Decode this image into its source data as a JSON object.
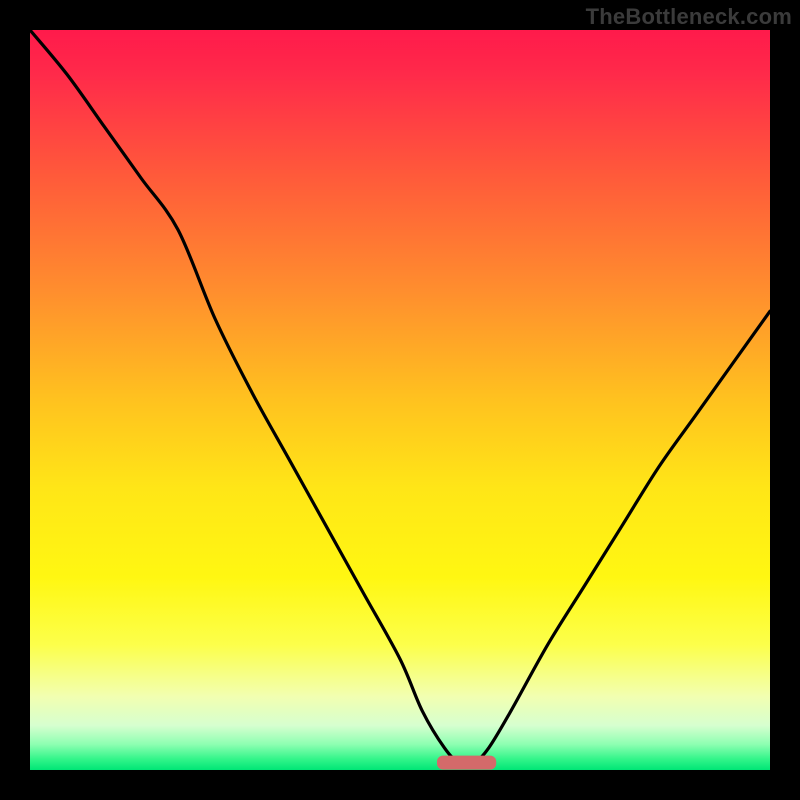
{
  "watermark": "TheBottleneck.com",
  "chart_data": {
    "type": "line",
    "title": "",
    "xlabel": "",
    "ylabel": "",
    "xlim": [
      0,
      100
    ],
    "ylim": [
      0,
      100
    ],
    "series": [
      {
        "name": "bottleneck-curve",
        "x": [
          0,
          5,
          10,
          15,
          20,
          25,
          30,
          35,
          40,
          45,
          50,
          53,
          56,
          58,
          60,
          62,
          65,
          70,
          75,
          80,
          85,
          90,
          95,
          100
        ],
        "y": [
          100,
          94,
          87,
          80,
          73,
          61,
          51,
          42,
          33,
          24,
          15,
          8,
          3,
          1,
          1,
          3,
          8,
          17,
          25,
          33,
          41,
          48,
          55,
          62
        ]
      }
    ],
    "marker": {
      "x_center": 59,
      "x_halfwidth": 4,
      "y": 1
    },
    "gradient_stops": [
      {
        "offset": 0.0,
        "color": "#ff1a4b"
      },
      {
        "offset": 0.06,
        "color": "#ff2a4a"
      },
      {
        "offset": 0.2,
        "color": "#ff5b3a"
      },
      {
        "offset": 0.35,
        "color": "#ff8d2e"
      },
      {
        "offset": 0.5,
        "color": "#ffc21f"
      },
      {
        "offset": 0.62,
        "color": "#ffe617"
      },
      {
        "offset": 0.74,
        "color": "#fff712"
      },
      {
        "offset": 0.83,
        "color": "#fcff4a"
      },
      {
        "offset": 0.9,
        "color": "#f2ffb0"
      },
      {
        "offset": 0.94,
        "color": "#d6ffcf"
      },
      {
        "offset": 0.965,
        "color": "#8effb2"
      },
      {
        "offset": 0.985,
        "color": "#34f58a"
      },
      {
        "offset": 1.0,
        "color": "#00e676"
      }
    ]
  }
}
